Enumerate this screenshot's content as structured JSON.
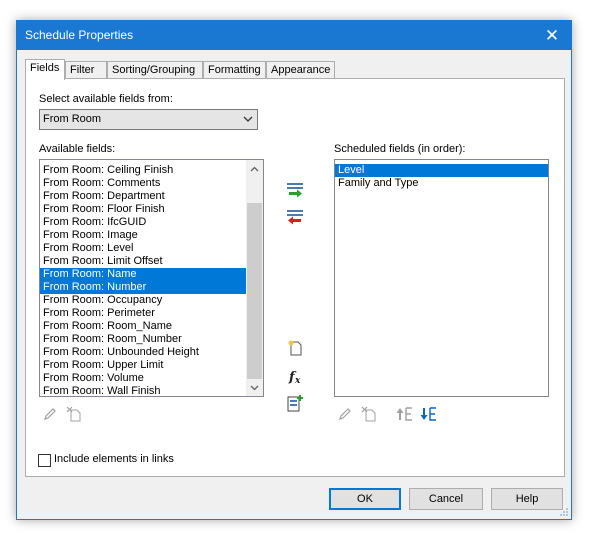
{
  "window": {
    "title": "Schedule Properties",
    "close_glyph": "✕"
  },
  "tabs": [
    {
      "label": "Fields",
      "active": true
    },
    {
      "label": "Filter"
    },
    {
      "label": "Sorting/Grouping"
    },
    {
      "label": "Formatting"
    },
    {
      "label": "Appearance"
    }
  ],
  "select_fields": {
    "label": "Select available fields from:",
    "value": "From Room"
  },
  "available": {
    "label": "Available fields:",
    "items": [
      "From Room: Ceiling Finish",
      "From Room: Comments",
      "From Room: Department",
      "From Room: Floor Finish",
      "From Room: IfcGUID",
      "From Room: Image",
      "From Room: Level",
      "From Room: Limit Offset",
      "From Room: Name",
      "From Room: Number",
      "From Room: Occupancy",
      "From Room: Perimeter",
      "From Room: Room_Name",
      "From Room: Room_Number",
      "From Room: Unbounded Height",
      "From Room: Upper Limit",
      "From Room: Volume",
      "From Room: Wall Finish"
    ],
    "selected": [
      "From Room: Name",
      "From Room: Number"
    ]
  },
  "scheduled": {
    "label": "Scheduled fields (in order):",
    "items": [
      "Level",
      "Family and Type"
    ],
    "selected": [
      "Level"
    ]
  },
  "include_links": {
    "label": "Include elements in links",
    "checked": false
  },
  "buttons": {
    "ok": "OK",
    "cancel": "Cancel",
    "help": "Help"
  },
  "icons": {
    "add": "add-field-icon",
    "remove": "remove-field-icon",
    "new_param": "new-parameter-icon",
    "calc": "calculated-value-icon",
    "combine": "combine-parameters-icon",
    "edit": "edit-parameter-icon",
    "delete": "delete-parameter-icon",
    "up": "move-up-icon",
    "down": "move-down-icon"
  },
  "colors": {
    "accent": "#1a77d2",
    "selection": "#0078d7",
    "add_arrow": "#2e9b2e",
    "remove_arrow": "#d42020"
  }
}
